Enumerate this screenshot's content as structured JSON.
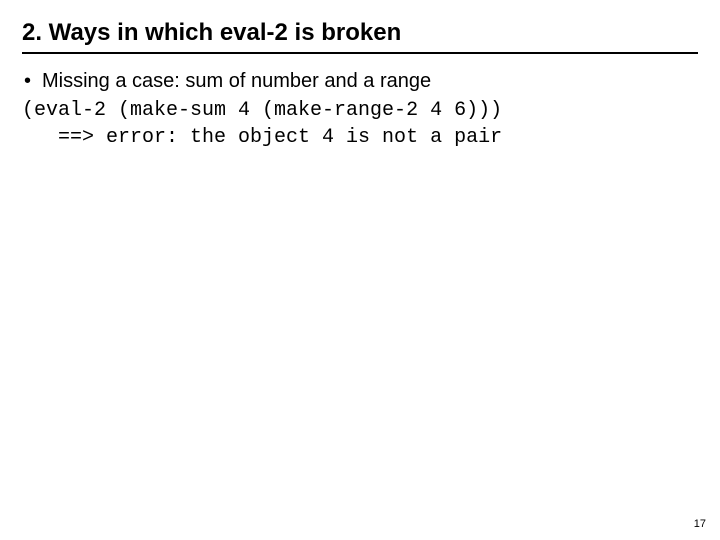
{
  "slide": {
    "title": "2. Ways in which eval-2 is broken",
    "bullet": "Missing a case: sum of number and a range",
    "code_line_1": "(eval-2 (make-sum 4 (make-range-2 4 6)))",
    "code_line_2": "   ==> error: the object 4 is not a pair",
    "page_number": "17"
  }
}
